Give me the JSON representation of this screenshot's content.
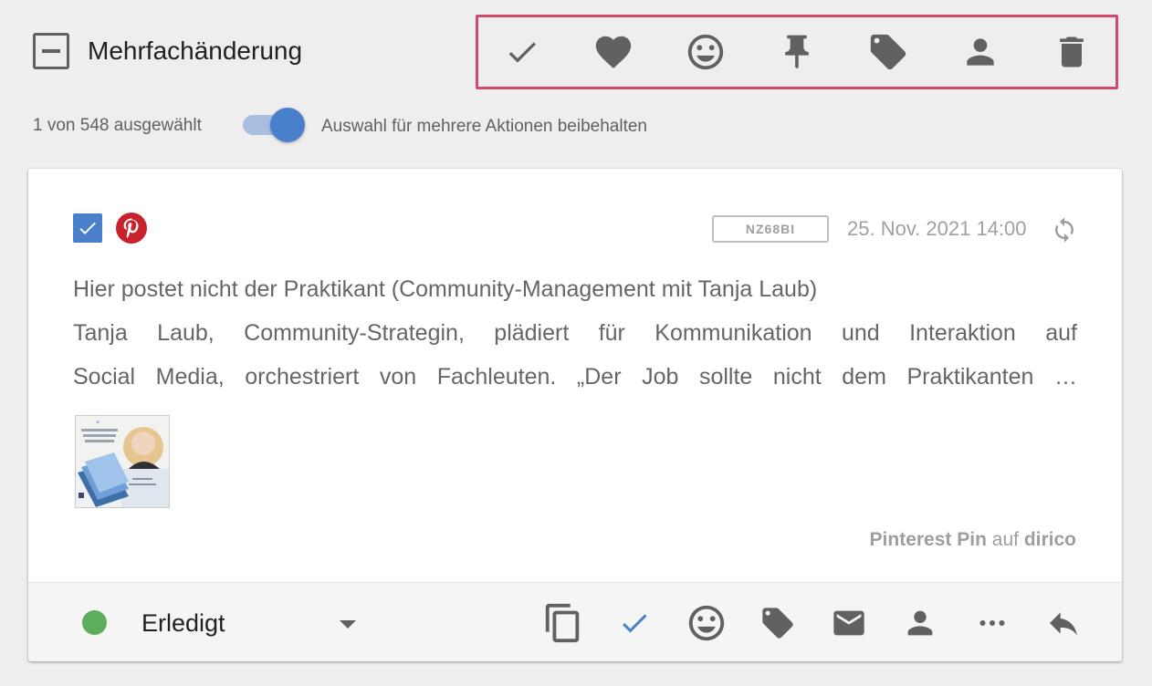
{
  "header": {
    "title": "Mehrfachänderung",
    "actions": [
      {
        "icon": "check-icon"
      },
      {
        "icon": "heart-icon"
      },
      {
        "icon": "smiley-icon"
      },
      {
        "icon": "pin-icon"
      },
      {
        "icon": "tag-icon"
      },
      {
        "icon": "person-icon"
      },
      {
        "icon": "trash-icon"
      }
    ],
    "highlight_color": "#d1496c"
  },
  "selection": {
    "count_text": "1 von 548 ausgewählt",
    "keep_selection_label": "Auswahl für mehrere Aktionen beibehalten",
    "keep_selection_on": true
  },
  "post": {
    "selected": true,
    "network_icon": "pinterest-icon",
    "id": "NZ68BI",
    "date": "25. Nov. 2021 14:00",
    "repeat_icon": "repeat-icon",
    "title_line": "Hier postet nicht der Praktikant (Community-Management mit Tanja Laub)",
    "body_line1": "Tanja Laub, Community-Strategin, plädiert für Kommunikation und Interaktion auf",
    "body_line2": "Social Media, orchestriert von Fachleuten. „Der Job sollte nicht dem Praktikanten …",
    "source_type": "Pinterest Pin",
    "source_connector": "auf",
    "source_account": "dirico",
    "accent_color": "#4a7fcc"
  },
  "footer": {
    "status_label": "Erledigt",
    "status_color": "#5cae5c",
    "actions": [
      {
        "icon": "copy-icon"
      },
      {
        "icon": "check-icon"
      },
      {
        "icon": "smiley-icon"
      },
      {
        "icon": "tag-icon"
      },
      {
        "icon": "mail-icon"
      },
      {
        "icon": "person-icon"
      },
      {
        "icon": "more-icon"
      },
      {
        "icon": "reply-icon"
      }
    ]
  }
}
